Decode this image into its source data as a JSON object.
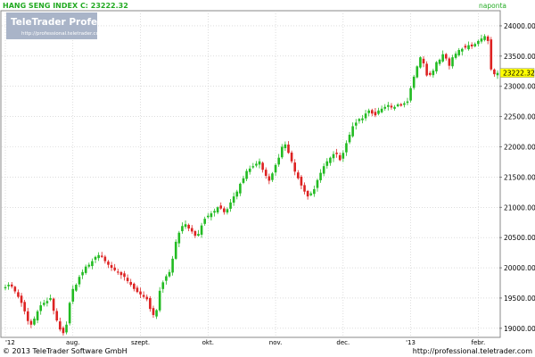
{
  "header": {
    "title_text": "HANG SENG INDEX C: 23222.32",
    "period_label": "naponta"
  },
  "watermark": {
    "brand": "TeleTrader Professional",
    "url": "http://professional.teletrader.com"
  },
  "footer": {
    "copyright": "© 2013 TeleTrader Software GmbH",
    "url": "http://professional.teletrader.com"
  },
  "colors": {
    "background": "#ffffff",
    "axis_panel": "#ffffff",
    "grid": "#c8c8c8",
    "up": "#22bb22",
    "down": "#dd2222",
    "last_price_bg": "#ffff00",
    "header_text": "#22aa22",
    "watermark_bg": "#a9b4c8"
  },
  "chart_data": {
    "type": "candlestick",
    "y_ticks": [
      19000,
      19500,
      20000,
      20500,
      21000,
      21500,
      22000,
      22500,
      23000,
      23500,
      24000
    ],
    "y_tick_labels": [
      "19000.00",
      "19500.00",
      "20000.00",
      "20500.00",
      "21000.00",
      "21500.00",
      "22000.00",
      "22500.00",
      "23000.00",
      "23500.00",
      "24000.00"
    ],
    "ylim": [
      18850,
      24250
    ],
    "last_price": 23222.32,
    "last_price_label": "23222.32",
    "x_tick_labels": [
      "'12",
      "aug.",
      "szept.",
      "okt.",
      "nov.",
      "dec.",
      "'13",
      "febr."
    ],
    "x_tick_index": [
      0,
      21,
      42,
      63,
      84,
      105,
      126,
      147
    ],
    "n_bars": 154,
    "closes": [
      19680,
      19720,
      19690,
      19610,
      19520,
      19420,
      19280,
      19120,
      19060,
      19160,
      19280,
      19380,
      19420,
      19450,
      19500,
      19290,
      19130,
      18980,
      18920,
      19060,
      19420,
      19650,
      19720,
      19850,
      19930,
      20020,
      20050,
      20110,
      20180,
      20210,
      20180,
      20110,
      20050,
      20000,
      19960,
      19920,
      19880,
      19850,
      19780,
      19720,
      19650,
      19600,
      19560,
      19520,
      19480,
      19320,
      19220,
      19300,
      19620,
      19760,
      19860,
      19930,
      20150,
      20430,
      20580,
      20690,
      20720,
      20650,
      20600,
      20530,
      20560,
      20700,
      20810,
      20860,
      20900,
      20940,
      21000,
      20980,
      20920,
      20970,
      21080,
      21180,
      21260,
      21390,
      21480,
      21600,
      21640,
      21680,
      21720,
      21760,
      21620,
      21520,
      21440,
      21560,
      21700,
      21820,
      22000,
      22040,
      21900,
      21760,
      21590,
      21480,
      21360,
      21260,
      21180,
      21230,
      21300,
      21450,
      21570,
      21680,
      21760,
      21820,
      21880,
      21880,
      21780,
      21900,
      22060,
      22200,
      22340,
      22400,
      22460,
      22470,
      22550,
      22600,
      22550,
      22520,
      22600,
      22630,
      22660,
      22690,
      22650,
      22660,
      22700,
      22680,
      22720,
      22750,
      22970,
      23160,
      23330,
      23480,
      23380,
      23180,
      23190,
      23260,
      23400,
      23440,
      23530,
      23460,
      23340,
      23480,
      23540,
      23600,
      23620,
      23640,
      23680,
      23660,
      23700,
      23750,
      23790,
      23830,
      23750,
      23280,
      23200,
      23222
    ],
    "ranges": [
      {
        "from": 0,
        "to": 30,
        "low": 18900,
        "high": 20250
      },
      {
        "from": 31,
        "to": 60,
        "low": 19100,
        "high": 20900
      },
      {
        "from": 61,
        "to": 90,
        "low": 20800,
        "high": 22100
      },
      {
        "from": 91,
        "to": 120,
        "low": 21100,
        "high": 22700
      },
      {
        "from": 121,
        "to": 153,
        "low": 22500,
        "high": 23950
      }
    ]
  }
}
